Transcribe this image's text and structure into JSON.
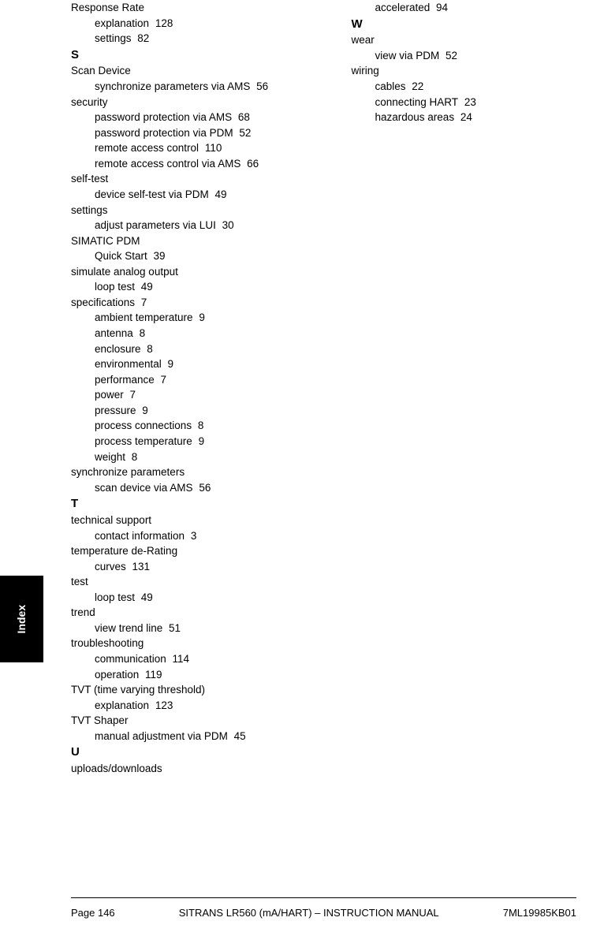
{
  "side_tab": "Index",
  "col1": [
    {
      "type": "entry",
      "text": "Response Rate",
      "page": ""
    },
    {
      "type": "sub",
      "text": "explanation",
      "page": "128"
    },
    {
      "type": "sub",
      "text": "settings",
      "page": "82"
    },
    {
      "type": "letter",
      "text": "S",
      "page": ""
    },
    {
      "type": "entry",
      "text": "Scan Device",
      "page": ""
    },
    {
      "type": "sub",
      "text": "synchronize parameters via AMS",
      "page": "56"
    },
    {
      "type": "entry",
      "text": "security",
      "page": ""
    },
    {
      "type": "sub",
      "text": "password protection via AMS",
      "page": "68"
    },
    {
      "type": "sub",
      "text": "password protection via PDM",
      "page": "52"
    },
    {
      "type": "sub",
      "text": "remote access control",
      "page": "110"
    },
    {
      "type": "sub",
      "text": "remote access control via AMS",
      "page": "66"
    },
    {
      "type": "entry",
      "text": "self-test",
      "page": ""
    },
    {
      "type": "sub",
      "text": "device self-test via PDM",
      "page": "49"
    },
    {
      "type": "entry",
      "text": "settings",
      "page": ""
    },
    {
      "type": "sub",
      "text": "adjust parameters via LUI",
      "page": "30"
    },
    {
      "type": "entry",
      "text": "SIMATIC PDM",
      "page": ""
    },
    {
      "type": "sub",
      "text": "Quick Start",
      "page": "39"
    },
    {
      "type": "entry",
      "text": "simulate analog output",
      "page": ""
    },
    {
      "type": "sub",
      "text": "loop test",
      "page": "49"
    },
    {
      "type": "entry",
      "text": "specifications",
      "page": "7"
    },
    {
      "type": "sub",
      "text": "ambient temperature",
      "page": "9"
    },
    {
      "type": "sub",
      "text": "antenna",
      "page": "8"
    },
    {
      "type": "sub",
      "text": "enclosure",
      "page": "8"
    },
    {
      "type": "sub",
      "text": "environmental",
      "page": "9"
    },
    {
      "type": "sub",
      "text": "performance",
      "page": "7"
    },
    {
      "type": "sub",
      "text": "power",
      "page": "7"
    },
    {
      "type": "sub",
      "text": "pressure",
      "page": "9"
    },
    {
      "type": "sub",
      "text": "process connections",
      "page": "8"
    },
    {
      "type": "sub",
      "text": "process temperature",
      "page": "9"
    },
    {
      "type": "sub",
      "text": "weight",
      "page": "8"
    },
    {
      "type": "entry",
      "text": "synchronize parameters",
      "page": ""
    },
    {
      "type": "sub",
      "text": "scan device via AMS",
      "page": "56"
    },
    {
      "type": "letter",
      "text": "T",
      "page": ""
    },
    {
      "type": "entry",
      "text": "technical support",
      "page": ""
    },
    {
      "type": "sub",
      "text": "contact information",
      "page": "3"
    },
    {
      "type": "entry",
      "text": "temperature de-Rating",
      "page": ""
    },
    {
      "type": "sub",
      "text": "curves",
      "page": "131"
    },
    {
      "type": "entry",
      "text": "test",
      "page": ""
    },
    {
      "type": "sub",
      "text": "loop test",
      "page": "49"
    },
    {
      "type": "entry",
      "text": "trend",
      "page": ""
    },
    {
      "type": "sub",
      "text": "view trend line",
      "page": "51"
    },
    {
      "type": "entry",
      "text": "troubleshooting",
      "page": ""
    },
    {
      "type": "sub",
      "text": "communication",
      "page": "114"
    },
    {
      "type": "sub",
      "text": "operation",
      "page": "119"
    },
    {
      "type": "entry",
      "text": "TVT (time varying threshold)",
      "page": ""
    },
    {
      "type": "sub",
      "text": "explanation",
      "page": "123"
    },
    {
      "type": "entry",
      "text": "TVT Shaper",
      "page": ""
    },
    {
      "type": "sub",
      "text": "manual adjustment via PDM",
      "page": "45"
    },
    {
      "type": "letter",
      "text": "U",
      "page": ""
    },
    {
      "type": "entry",
      "text": "uploads/downloads",
      "page": ""
    }
  ],
  "col2": [
    {
      "type": "sub",
      "text": "accelerated",
      "page": "94"
    },
    {
      "type": "letter",
      "text": "W",
      "page": ""
    },
    {
      "type": "entry",
      "text": "wear",
      "page": ""
    },
    {
      "type": "sub",
      "text": "view via PDM",
      "page": "52"
    },
    {
      "type": "entry",
      "text": "wiring",
      "page": ""
    },
    {
      "type": "sub",
      "text": "cables",
      "page": "22"
    },
    {
      "type": "sub",
      "text": "connecting HART",
      "page": "23"
    },
    {
      "type": "sub",
      "text": "hazardous areas",
      "page": "24"
    }
  ],
  "footer": {
    "left": "Page 146",
    "center": "SITRANS LR560 (mA/HART) – INSTRUCTION MANUAL",
    "right": "7ML19985KB01"
  }
}
